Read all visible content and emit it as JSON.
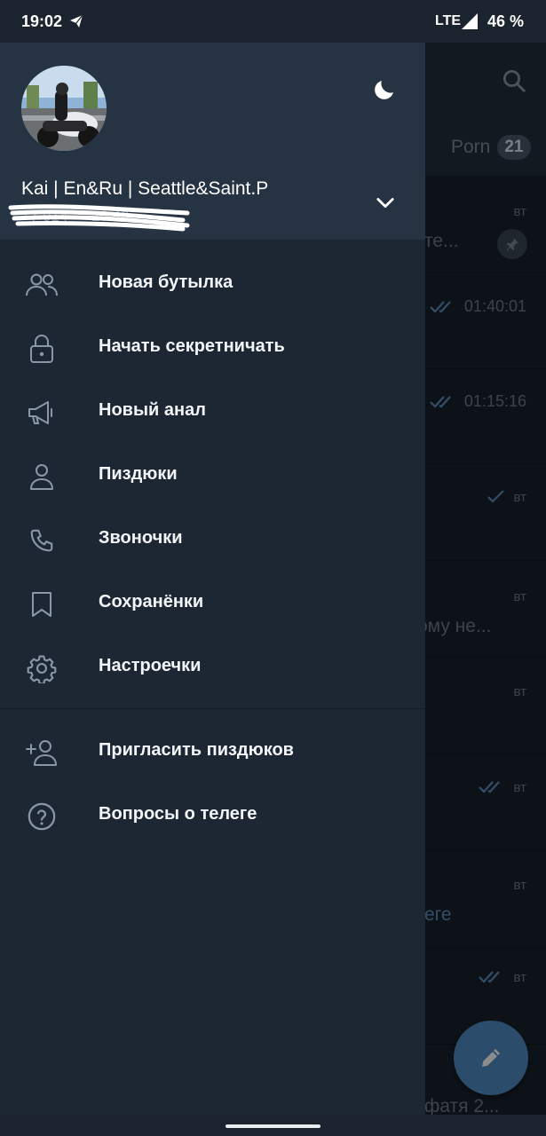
{
  "status_bar": {
    "time": "19:02",
    "network": "LTE",
    "battery": "46 %"
  },
  "background_chats": {
    "tab_label": "Porn",
    "tab_count": "21",
    "rows": [
      {
        "time": "вт",
        "snippet": "те..."
      },
      {
        "time": "01:40:01",
        "snippet": ""
      },
      {
        "time": "01:15:16",
        "snippet": ""
      },
      {
        "time": "вт",
        "snippet": ""
      },
      {
        "time": "вт",
        "snippet": "ому не..."
      },
      {
        "time": "вт",
        "snippet": ""
      },
      {
        "time": "вт",
        "snippet": ""
      },
      {
        "time": "вт",
        "snippet": "еге"
      },
      {
        "time": "вт",
        "snippet": ""
      },
      {
        "time": "",
        "snippet": "фатя 2..."
      }
    ]
  },
  "drawer": {
    "profile": {
      "name": "Kai | En&Ru | Seattle&Saint.P",
      "phone": "+7 914 ··· 20 46"
    },
    "menu": [
      {
        "label": "Новая бутылка",
        "icon": "new-group-icon"
      },
      {
        "label": "Начать секретничать",
        "icon": "lock-icon"
      },
      {
        "label": "Новый анал",
        "icon": "megaphone-icon"
      },
      {
        "label": "Пиздюки",
        "icon": "person-icon"
      },
      {
        "label": "Звоночки",
        "icon": "phone-icon"
      },
      {
        "label": "Сохранёнки",
        "icon": "bookmark-icon"
      },
      {
        "label": "Настроечки",
        "icon": "gear-icon"
      }
    ],
    "secondary_menu": [
      {
        "label": "Пригласить пиздюков",
        "icon": "add-person-icon"
      },
      {
        "label": "Вопросы о телеге",
        "icon": "help-icon"
      }
    ]
  },
  "colors": {
    "drawer_bg": "#1d2733",
    "header_bg": "#263342",
    "accent": "#4f8ac4",
    "icon_gray": "#8898a8"
  }
}
